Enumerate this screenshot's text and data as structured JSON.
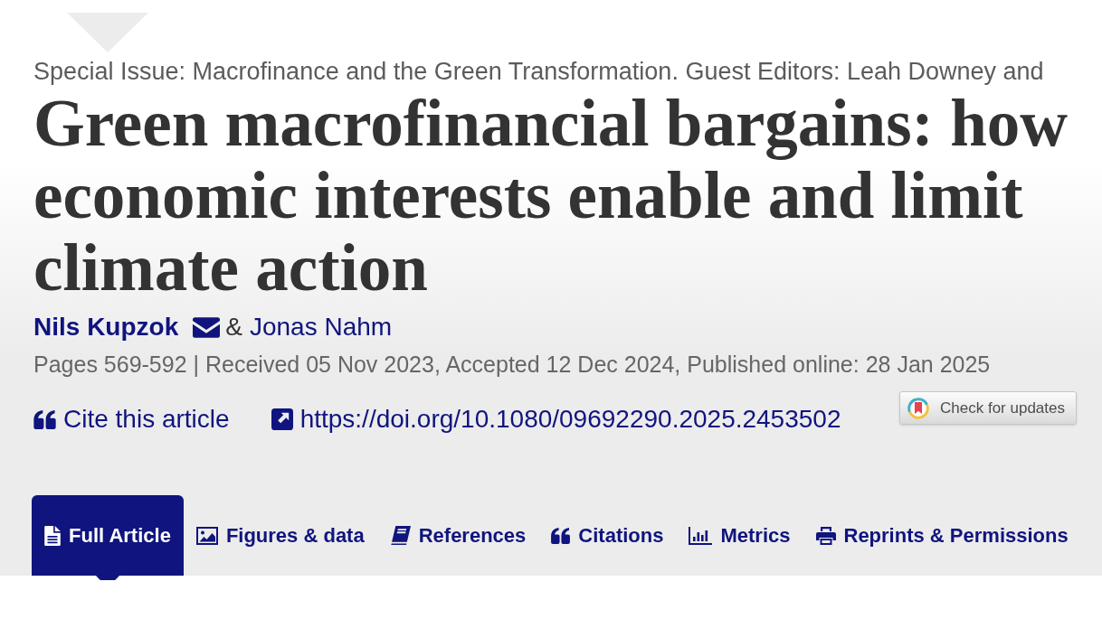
{
  "special_issue": "Special Issue: Macrofinance and the Green Transformation. Guest Editors: Leah Downey and",
  "title": "Green macrofinancial bargains: how economic interests enable and limit climate action",
  "authors": [
    {
      "name": "Nils Kupzok",
      "corresponding": true
    },
    {
      "name": "Jonas Nahm",
      "corresponding": false
    }
  ],
  "author_separator": "&",
  "publication_info": "Pages 569-592 | Received 05 Nov 2023, Accepted 12 Dec 2024, Published online: 28 Jan 2025",
  "links": [
    {
      "kind": "cite",
      "label": "Cite this article"
    },
    {
      "kind": "doi",
      "label": "https://doi.org/10.1080/09692290.2025.2453502"
    }
  ],
  "update_button": {
    "label": "Check for updates"
  },
  "tabs": [
    {
      "kind": "full-article",
      "label": "Full Article",
      "selected": true
    },
    {
      "kind": "figures",
      "label": "Figures & data",
      "selected": false
    },
    {
      "kind": "references",
      "label": "References",
      "selected": false
    },
    {
      "kind": "citations",
      "label": "Citations",
      "selected": false
    },
    {
      "kind": "metrics",
      "label": "Metrics",
      "selected": false
    },
    {
      "kind": "reprints",
      "label": "Reprints & Permissions",
      "selected": false
    }
  ]
}
